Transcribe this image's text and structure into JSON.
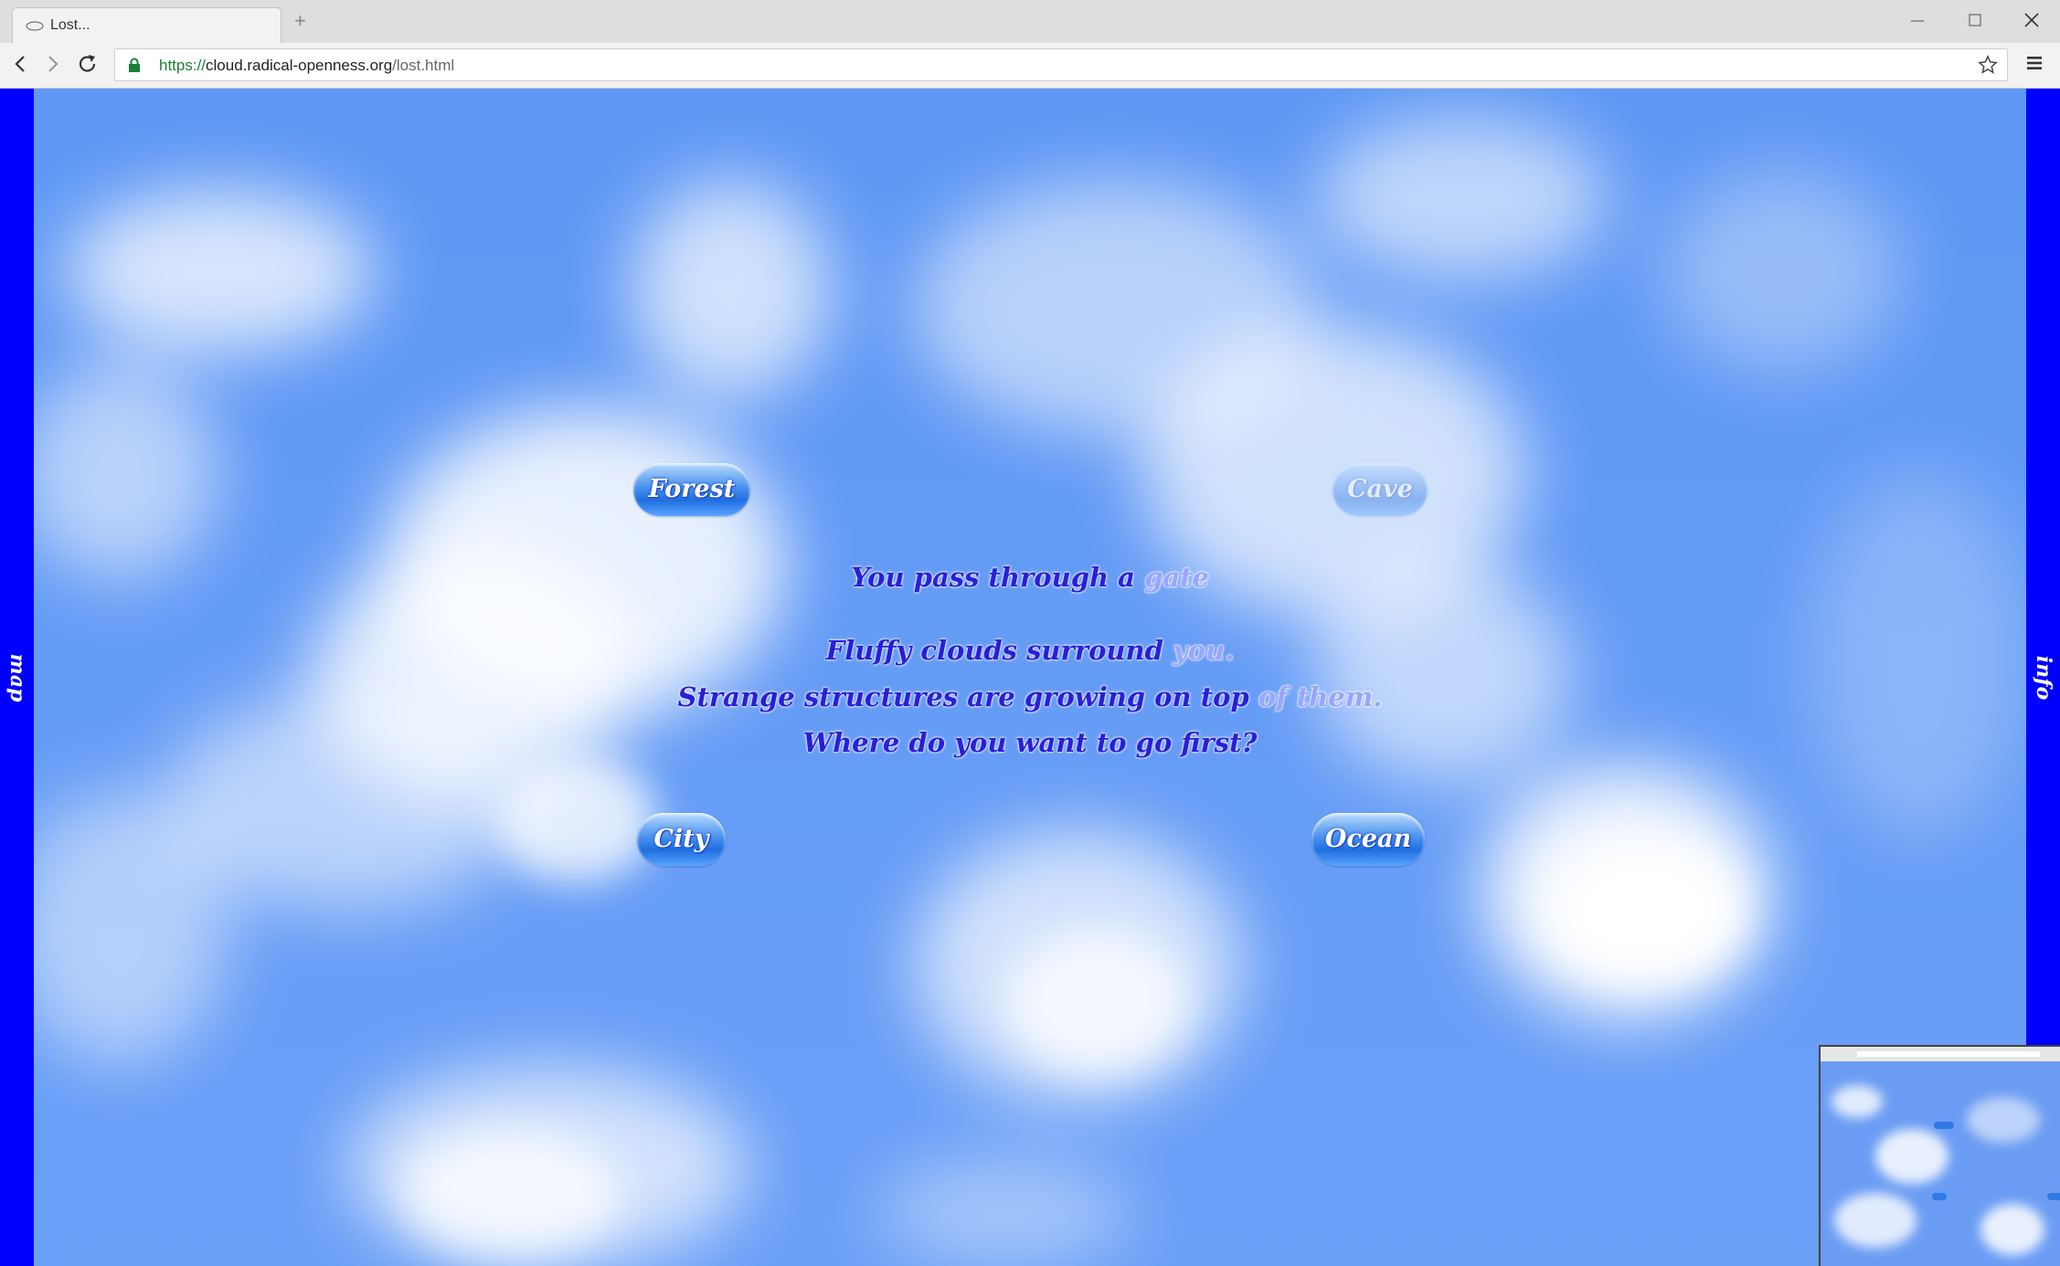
{
  "browser": {
    "tab_title": "Lost...",
    "new_tab_icon": "+",
    "url_scheme": "https://",
    "url_host": "cloud.radical-openness.org",
    "url_path": "/lost.html"
  },
  "page": {
    "left_panel_label": "map",
    "right_panel_label": "info",
    "destinations": {
      "forest": "Forest",
      "cave": "Cave",
      "city": "City",
      "ocean": "Ocean"
    },
    "story": {
      "line1_main": "You pass through a ",
      "line1_faded": "gate",
      "line2_main": "Fluffy clouds surround ",
      "line2_faded": "you.",
      "line3_main": "Strange structures are growing on top ",
      "line3_faded": "of them.",
      "line4": "Where do you want to go first?"
    }
  },
  "colors": {
    "sky": "#6d9ff6",
    "side_panel": "#0000ff",
    "story_text": "#2a1ed8"
  },
  "icons": [
    "back-icon",
    "forward-icon",
    "reload-icon",
    "lock-icon",
    "star-icon",
    "menu-icon",
    "minimize-icon",
    "maximize-icon",
    "close-icon",
    "cloud-icon"
  ]
}
